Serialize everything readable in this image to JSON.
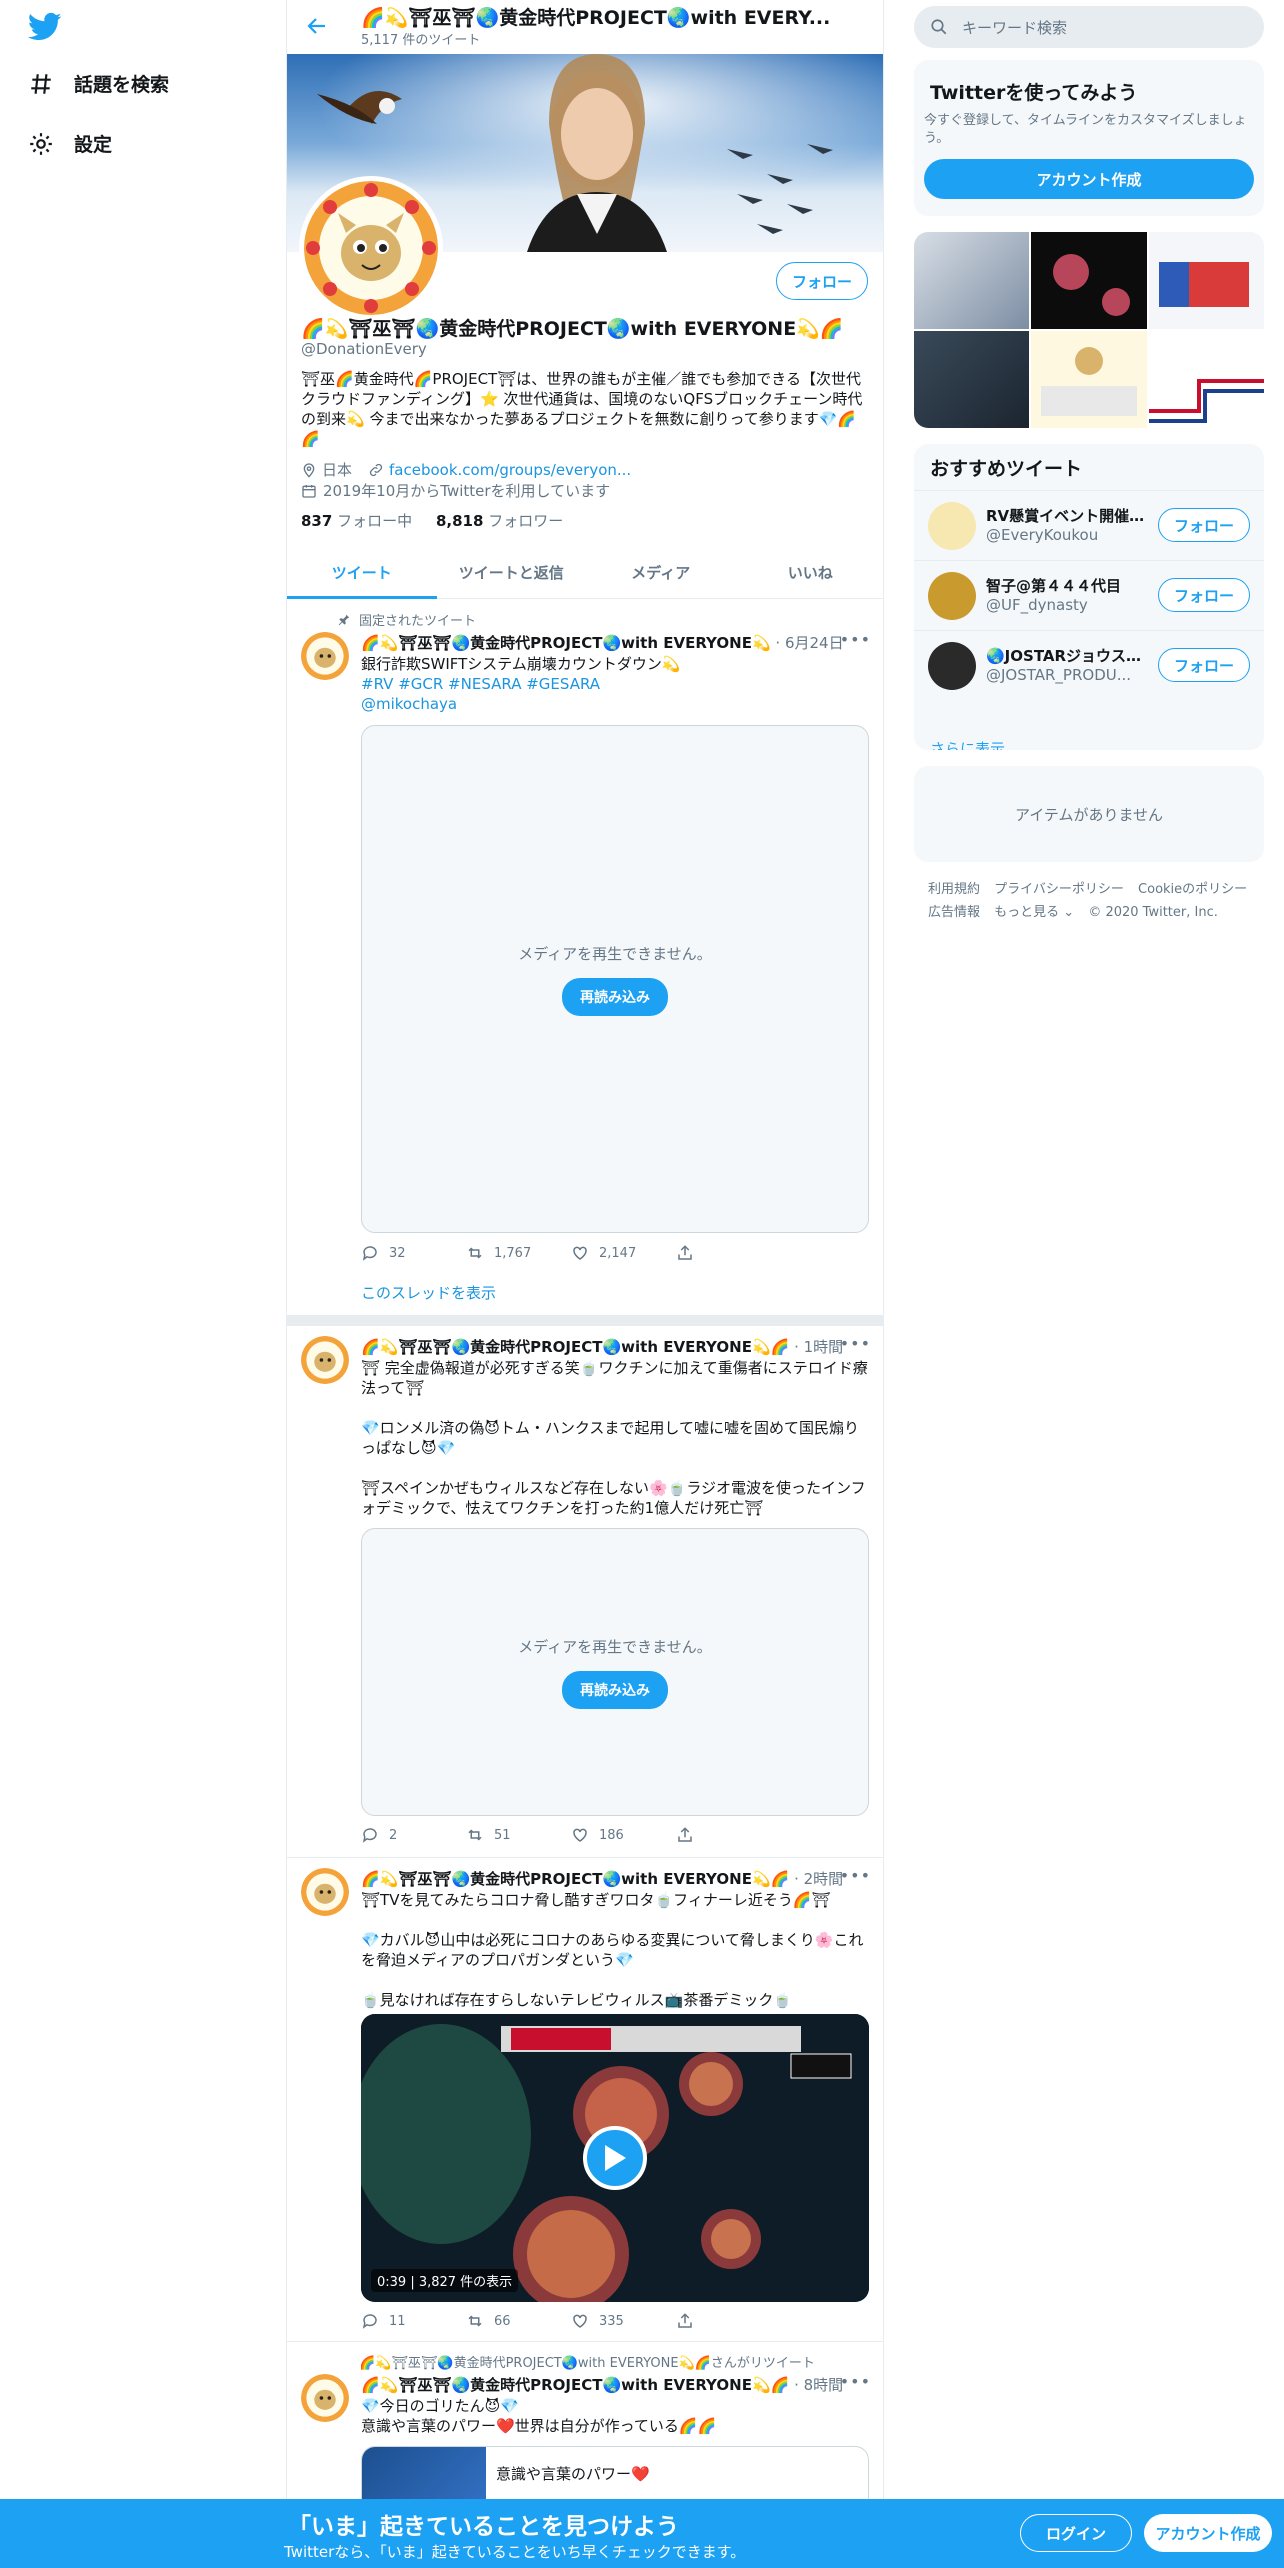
{
  "nav": {
    "logo": "twitter-bird-icon",
    "explore_label": "話題を検索",
    "settings_label": "設定"
  },
  "header": {
    "title": "🌈💫⛩巫⛩🌏黄金時代PROJECT🌏with EVERY...",
    "tweet_count": "5,117 件のツイート"
  },
  "profile": {
    "name": "🌈💫⛩巫⛩🌏黄金時代PROJECT🌏with EVERYONE💫🌈",
    "handle": "@DonationEvery",
    "follow_label": "フォロー",
    "bio": "⛩巫🌈黄金時代🌈PROJECT⛩は、世界の誰もが主催／誰でも参加できる【次世代クラウドファンディング】⭐ 次世代通貨は、国境のないQFSブロックチェーン時代の到来💫 今まで出来なかった夢あるプロジェクトを無数に創りって参ります💎🌈🌈",
    "location": "日本",
    "url": "facebook.com/groups/everyon...",
    "joined": "2019年10月からTwitterを利用しています",
    "following_count": "837",
    "following_label": "フォロー中",
    "followers_count": "8,818",
    "followers_label": "フォロワー"
  },
  "tabs": [
    "ツイート",
    "ツイートと返信",
    "メディア",
    "いいね"
  ],
  "tweets": [
    {
      "pinned_label": "固定されたツイート",
      "name": "🌈💫⛩巫⛩🌏黄金時代PROJECT🌏with EVERYONE💫",
      "time": "· 6月24日",
      "lines": [
        "銀行詐欺SWIFTシステム崩壊カウントダウン💫"
      ],
      "hashtags": "#RV #GCR #NESARA #GESARA",
      "mention": "@mikochaya",
      "media_msg": "メディアを再生できません。",
      "reload": "再読み込み",
      "replies": "32",
      "retweets": "1,767",
      "likes": "2,147",
      "thread": "このスレッドを表示"
    },
    {
      "name": "🌈💫⛩巫⛩🌏黄金時代PROJECT🌏with EVERYONE💫🌈",
      "time": "· 1時間",
      "p1": "⛩ 完全虚偽報道が必死すぎる笑🍵ワクチンに加えて重傷者にステロイド療法って⛩",
      "p2": "💎ロンメル済の偽😈トム・ハンクスまで起用して嘘に嘘を固めて国民煽りっぱなし😈💎",
      "p3": "⛩スペインかぜもウィルスなど存在しない🌸🍵ラジオ電波を使ったインフォデミックで、怯えてワクチンを打った約1億人だけ死亡⛩",
      "media_msg": "メディアを再生できません。",
      "reload": "再読み込み",
      "replies": "2",
      "retweets": "51",
      "likes": "186"
    },
    {
      "name": "🌈💫⛩巫⛩🌏黄金時代PROJECT🌏with EVERYONE💫🌈",
      "time": "· 2時間",
      "p1": "⛩TVを見てみたらコロナ脅し酷すぎワロタ🍵フィナーレ近そう🌈⛩",
      "p2": "💎カバル😈山中は必死にコロナのあらゆる変異について脅しまくり🌸これを脅迫メディアのプロパガンダという💎",
      "p3": "🍵見なければ存在すらしないテレビウィルス📺茶番デミック🍵",
      "video_time": "0:39 | 3,827 件の表示",
      "replies": "11",
      "retweets": "66",
      "likes": "335"
    },
    {
      "retweeted_by": "🌈💫⛩巫⛩🌏黄金時代PROJECT🌏with EVERYONE💫🌈さんがリツイート",
      "name": "🌈💫⛩巫⛩🌏黄金時代PROJECT🌏with EVERYONE💫🌈",
      "time": "· 8時間",
      "p1": "💎今日のゴリたん😈💎",
      "p2": "意識や言葉のパワー❤️世界は自分が作っている🌈🌈",
      "card_title": "意識や言葉のパワー❤️"
    }
  ],
  "right": {
    "search_placeholder": "キーワード検索",
    "join_title": "Twitterを使ってみよう",
    "join_text": "今すぐ登録して、タイムラインをカスタマイズしましょう。",
    "join_button": "アカウント作成",
    "rec_title": "おすすめツイート",
    "rec": [
      {
        "name": "RV懸賞イベント開催…",
        "handle": "@EveryKoukou"
      },
      {
        "name": "智子@第４４４代目",
        "handle": "@UF_dynasty"
      },
      {
        "name": "🌏JOSTARジョウス…",
        "handle": "@JOSTAR_PRODU..."
      }
    ],
    "rec_follow": "フォロー",
    "rec_more": "さらに表示",
    "empty": "アイテムがありません",
    "footer": [
      "利用規約",
      "プライバシーポリシー",
      "Cookieのポリシー",
      "広告情報",
      "もっと見る ⌄",
      "© 2020 Twitter, Inc."
    ]
  },
  "bottombar": {
    "title": "「いま」起きていることを見つけよう",
    "subtitle": "Twitterなら、「いま」起きていることをいち早くチェックできます。",
    "login": "ログイン",
    "signup": "アカウント作成"
  },
  "colors": {
    "accent": "#1da1f2",
    "border": "#e6ecf0",
    "secondary_text": "#657786"
  }
}
